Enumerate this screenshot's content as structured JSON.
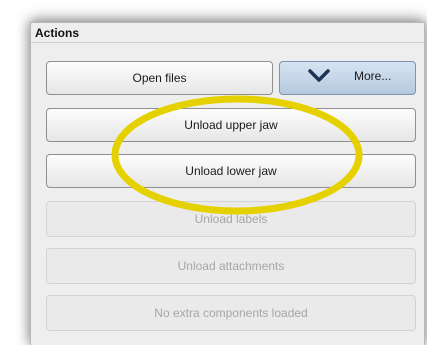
{
  "panel": {
    "title": "Actions"
  },
  "buttons": {
    "open_files": "Open files",
    "more": "More...",
    "unload_upper_jaw": "Unload upper jaw",
    "unload_lower_jaw": "Unload lower jaw",
    "unload_labels": "Unload labels",
    "unload_attachments": "Unload attachments",
    "no_extra_components": "No extra components loaded"
  },
  "icons": {
    "more": "chevron-down-icon"
  },
  "colors": {
    "highlight_ellipse": "#e6d100",
    "more_button": "#c4d6ea",
    "chevron": "#1c3550"
  }
}
